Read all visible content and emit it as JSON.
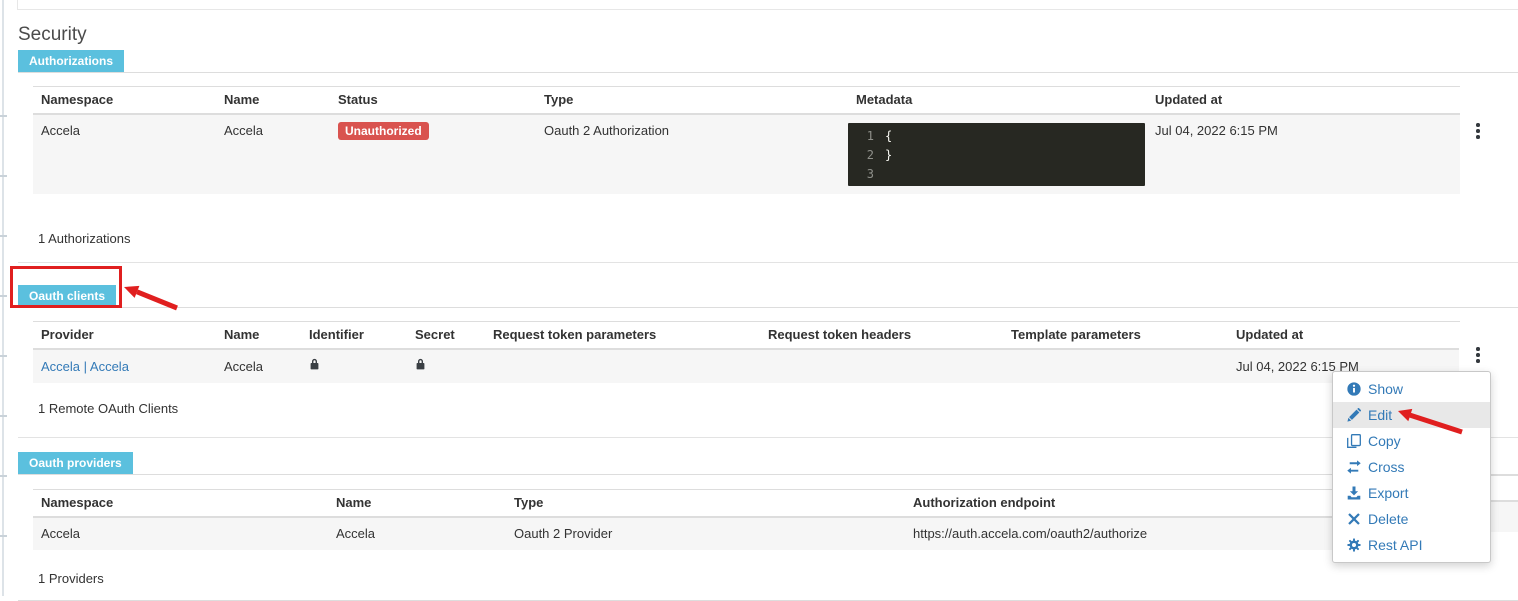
{
  "page": {
    "title": "Security"
  },
  "colors": {
    "tab_bg": "#5bc0de",
    "status_danger_bg": "#d9534f",
    "link": "#337ab7",
    "annotation_red": "#e01f1f",
    "code_editor_bg": "#272822"
  },
  "sections": {
    "authorizations": {
      "tab_label": "Authorizations",
      "columns": [
        "Namespace",
        "Name",
        "Status",
        "Type",
        "Metadata",
        "Updated at"
      ],
      "row": {
        "namespace": "Accela",
        "name": "Accela",
        "status": "Unauthorized",
        "type": "Oauth 2 Authorization",
        "metadata_editor": {
          "lines": [
            {
              "number": "1",
              "code": "{"
            },
            {
              "number": "2",
              "code": "}"
            },
            {
              "number": "3",
              "code": ""
            }
          ]
        },
        "updated_at": "Jul 04, 2022 6:15 PM"
      },
      "footer_count": "1 Authorizations"
    },
    "oauth_clients": {
      "tab_label": "Oauth clients",
      "columns": [
        "Provider",
        "Name",
        "Identifier",
        "Secret",
        "Request token parameters",
        "Request token headers",
        "Template parameters",
        "Updated at"
      ],
      "row": {
        "provider": "Accela | Accela",
        "name": "Accela",
        "identifier_icon": "lock-icon",
        "secret_icon": "lock-icon",
        "updated_at": "Jul 04, 2022 6:15 PM"
      },
      "footer_count": "1 Remote OAuth Clients"
    },
    "oauth_providers": {
      "tab_label": "Oauth providers",
      "columns": [
        "Namespace",
        "Name",
        "Type",
        "Authorization endpoint"
      ],
      "row": {
        "namespace": "Accela",
        "name": "Accela",
        "type": "Oauth 2 Provider",
        "authorization_endpoint": "https://auth.accela.com/oauth2/authorize"
      },
      "footer_count": "1 Providers"
    }
  },
  "context_menu": {
    "items": [
      {
        "icon": "info-icon",
        "label": "Show",
        "highlighted": false
      },
      {
        "icon": "pencil-icon",
        "label": "Edit",
        "highlighted": true
      },
      {
        "icon": "copy-icon",
        "label": "Copy",
        "highlighted": false
      },
      {
        "icon": "cross-icon",
        "label": "Cross",
        "highlighted": false
      },
      {
        "icon": "export-icon",
        "label": "Export",
        "highlighted": false
      },
      {
        "icon": "delete-icon",
        "label": "Delete",
        "highlighted": false
      },
      {
        "icon": "gear-icon",
        "label": "Rest API",
        "highlighted": false
      }
    ]
  }
}
